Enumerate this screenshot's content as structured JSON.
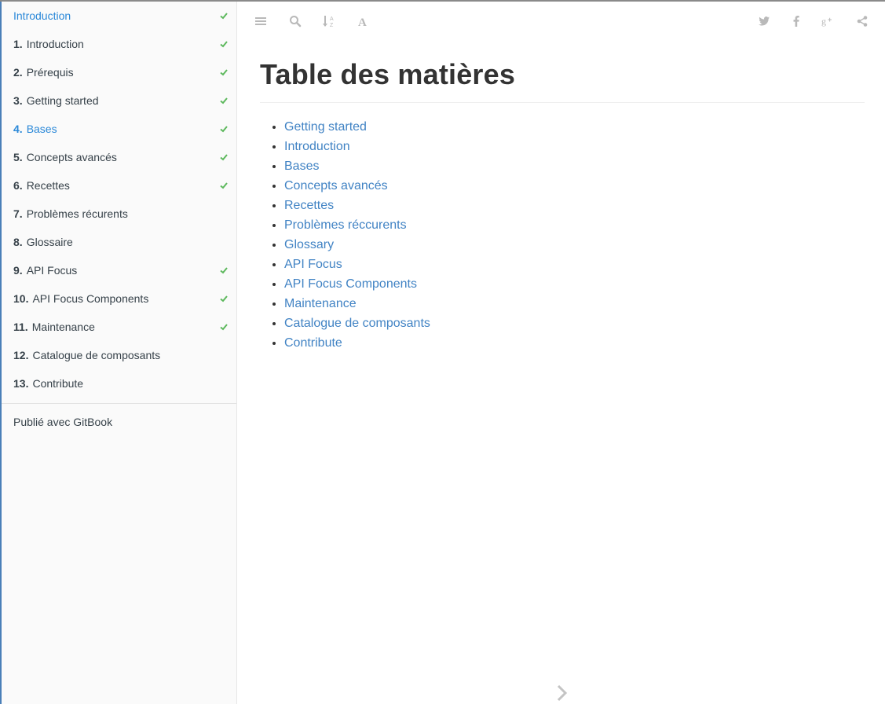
{
  "sidebar": {
    "items": [
      {
        "num": "",
        "label": "Introduction",
        "checked": true,
        "active": true
      },
      {
        "num": "1.",
        "label": "Introduction",
        "checked": true,
        "active": false
      },
      {
        "num": "2.",
        "label": "Prérequis",
        "checked": true,
        "active": false
      },
      {
        "num": "3.",
        "label": "Getting started",
        "checked": true,
        "active": false
      },
      {
        "num": "4.",
        "label": "Bases",
        "checked": true,
        "active": true
      },
      {
        "num": "5.",
        "label": "Concepts avancés",
        "checked": true,
        "active": false
      },
      {
        "num": "6.",
        "label": "Recettes",
        "checked": true,
        "active": false
      },
      {
        "num": "7.",
        "label": "Problèmes récurents",
        "checked": false,
        "active": false
      },
      {
        "num": "8.",
        "label": "Glossaire",
        "checked": false,
        "active": false
      },
      {
        "num": "9.",
        "label": "API Focus",
        "checked": true,
        "active": false
      },
      {
        "num": "10.",
        "label": "API Focus Components",
        "checked": true,
        "active": false
      },
      {
        "num": "11.",
        "label": "Maintenance",
        "checked": true,
        "active": false
      },
      {
        "num": "12.",
        "label": "Catalogue de composants",
        "checked": false,
        "active": false
      },
      {
        "num": "13.",
        "label": "Contribute",
        "checked": false,
        "active": false
      }
    ],
    "published": "Publié avec GitBook"
  },
  "toolbar": {
    "left_icons": [
      "menu-icon",
      "search-icon",
      "sort-alpha-icon",
      "font-icon"
    ],
    "right_icons": [
      "twitter-icon",
      "facebook-icon",
      "google-plus-icon",
      "share-icon"
    ]
  },
  "main": {
    "title": "Table des matières",
    "toc": [
      "Getting started",
      "Introduction",
      "Bases",
      "Concepts avancés",
      "Recettes",
      "Problèmes réccurents",
      "Glossary",
      "API Focus",
      "API Focus Components",
      "Maintenance",
      "Catalogue de composants",
      "Contribute"
    ]
  },
  "colors": {
    "active": "#2a88d8",
    "link": "#4183c4",
    "check": "#5cb85c",
    "icon": "#b9b9b9"
  }
}
